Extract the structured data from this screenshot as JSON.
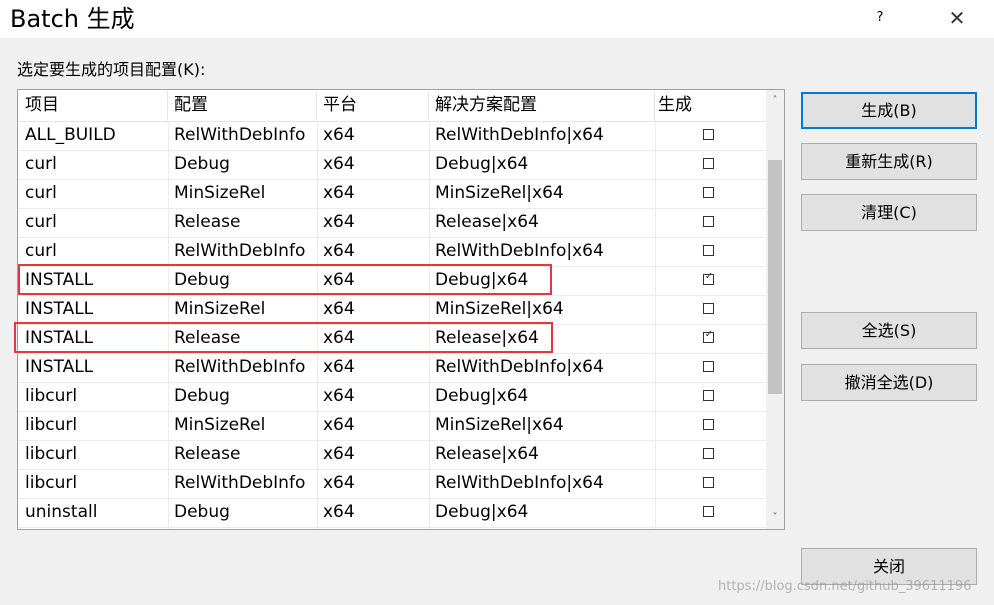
{
  "window": {
    "title": "Batch 生成",
    "help": "?",
    "close": "✕"
  },
  "prompt": "选定要生成的项目配置(K):",
  "grid": {
    "headers": {
      "project": "项目",
      "config": "配置",
      "platform": "平台",
      "solution_config": "解决方案配置",
      "build": "生成"
    },
    "rows": [
      {
        "project": "ALL_BUILD",
        "config": "RelWithDebInfo",
        "platform": "x64",
        "solution_config": "RelWithDebInfo|x64",
        "checked": false,
        "mark": ""
      },
      {
        "project": "curl",
        "config": "Debug",
        "platform": "x64",
        "solution_config": "Debug|x64",
        "checked": false,
        "mark": ""
      },
      {
        "project": "curl",
        "config": "MinSizeRel",
        "platform": "x64",
        "solution_config": "MinSizeRel|x64",
        "checked": false,
        "mark": ""
      },
      {
        "project": "curl",
        "config": "Release",
        "platform": "x64",
        "solution_config": "Release|x64",
        "checked": false,
        "mark": ""
      },
      {
        "project": "curl",
        "config": "RelWithDebInfo",
        "platform": "x64",
        "solution_config": "RelWithDebInfo|x64",
        "checked": false,
        "mark": ""
      },
      {
        "project": "INSTALL",
        "config": "Debug",
        "platform": "x64",
        "solution_config": "Debug|x64",
        "checked": true,
        "mark": "✓"
      },
      {
        "project": "INSTALL",
        "config": "MinSizeRel",
        "platform": "x64",
        "solution_config": "MinSizeRel|x64",
        "checked": false,
        "mark": ""
      },
      {
        "project": "INSTALL",
        "config": "Release",
        "platform": "x64",
        "solution_config": "Release|x64",
        "checked": true,
        "mark": "✓"
      },
      {
        "project": "INSTALL",
        "config": "RelWithDebInfo",
        "platform": "x64",
        "solution_config": "RelWithDebInfo|x64",
        "checked": false,
        "mark": ""
      },
      {
        "project": "libcurl",
        "config": "Debug",
        "platform": "x64",
        "solution_config": "Debug|x64",
        "checked": false,
        "mark": ""
      },
      {
        "project": "libcurl",
        "config": "MinSizeRel",
        "platform": "x64",
        "solution_config": "MinSizeRel|x64",
        "checked": false,
        "mark": ""
      },
      {
        "project": "libcurl",
        "config": "Release",
        "platform": "x64",
        "solution_config": "Release|x64",
        "checked": false,
        "mark": ""
      },
      {
        "project": "libcurl",
        "config": "RelWithDebInfo",
        "platform": "x64",
        "solution_config": "RelWithDebInfo|x64",
        "checked": false,
        "mark": ""
      },
      {
        "project": "uninstall",
        "config": "Debug",
        "platform": "x64",
        "solution_config": "Debug|x64",
        "checked": false,
        "mark": ""
      }
    ],
    "scroll_up": "˄",
    "scroll_down": "˅"
  },
  "buttons": {
    "build": "生成(B)",
    "rebuild": "重新生成(R)",
    "clean": "清理(C)",
    "select_all": "全选(S)",
    "deselect_all": "撤消全选(D)",
    "close": "关闭"
  },
  "colors": {
    "highlight": "#e0393e",
    "accent": "#0078d7"
  },
  "watermark": "https://blog.csdn.net/github_39611196"
}
